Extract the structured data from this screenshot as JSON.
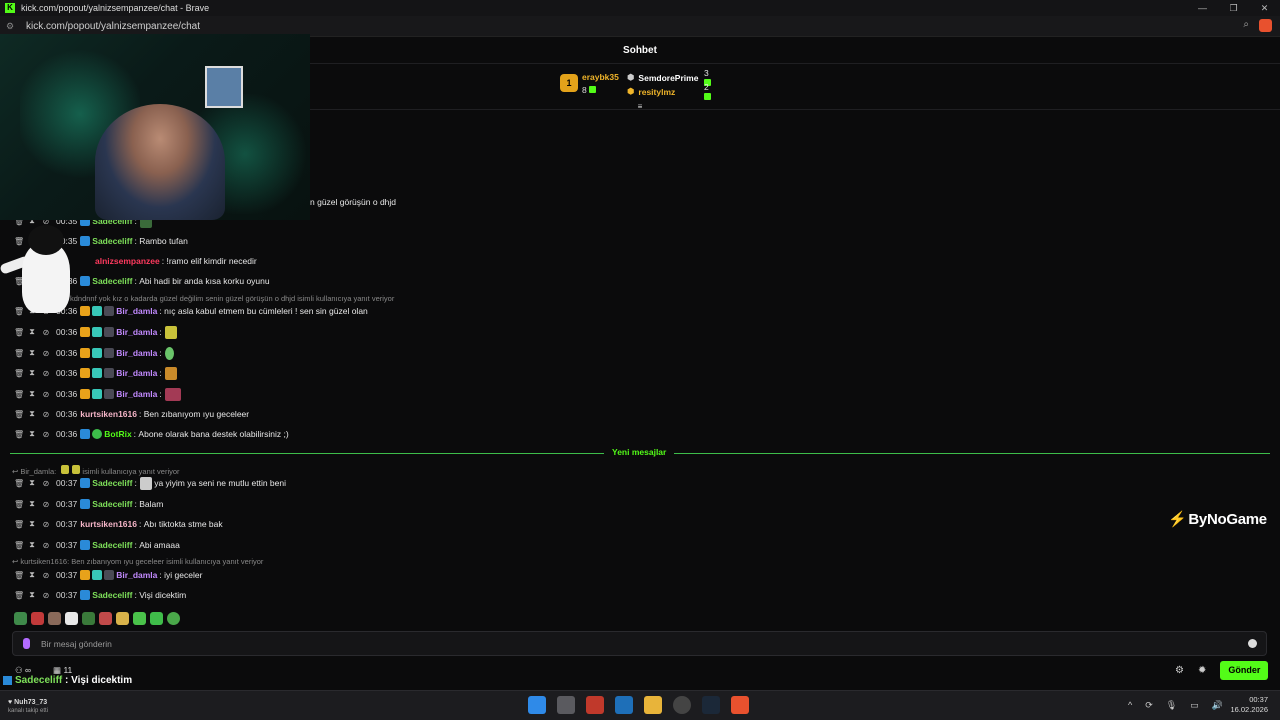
{
  "window": {
    "title": "kick.com/popout/yalnizsempanzee/chat - Brave",
    "controls": [
      "—",
      "❐",
      "✕"
    ]
  },
  "address_bar": {
    "url": "kick.com/popout/yalnizsempanzee/chat"
  },
  "chat_header": {
    "title": "Sohbet"
  },
  "leaderboard": {
    "rank": "1",
    "first": {
      "name": "eraybk35",
      "count": "8"
    },
    "others": [
      {
        "name": "SemdorePrime",
        "count": "3",
        "color": "#ffffff"
      },
      {
        "name": "resitylmz",
        "count": "2",
        "color": "#f0b52a"
      }
    ]
  },
  "partial_message": {
    "text": "n güzel görüşün o dhjd"
  },
  "messages_top": [
    {
      "time": "00:35",
      "user": "Sadeceliff",
      "sep": ":",
      "text": "",
      "cls": "un-green"
    },
    {
      "time": "00:35",
      "user": "Sadeceliff",
      "sep": ":",
      "text": "Rambo tufan",
      "cls": "un-green"
    },
    {
      "time": "",
      "user": "alnizsempanzee",
      "sep": ":",
      "text": "!ramo elif kimdir necedir",
      "cls": "un-red"
    },
    {
      "time": "00:36",
      "user": "Sadeceliff",
      "sep": ":",
      "text": "Abi hadi bir anda kısa korku oyunu",
      "cls": "un-green"
    }
  ],
  "reply_1": "kdndnnf yok kız o kadarda güzel değilim senin güzel görüşün o dhjd isimli kullanıcıya yanıt veriyor",
  "messages_mid": [
    {
      "time": "00:36",
      "user": "Bir_damla",
      "text": "nıç asla kabul etmem bu cümleleri ! sen sin güzel olan"
    },
    {
      "time": "00:36",
      "user": "Bir_damla",
      "text": ""
    },
    {
      "time": "00:36",
      "user": "Bir_damla",
      "text": ""
    },
    {
      "time": "00:36",
      "user": "Bir_damla",
      "text": ""
    },
    {
      "time": "00:36",
      "user": "Bir_damla",
      "text": ""
    }
  ],
  "msg_kurtsiken_1": {
    "time": "00:36",
    "user": "kurtsiken1616",
    "text": "Ben zıbanıyom ıyu geceleer"
  },
  "msg_botrix": {
    "time": "00:36",
    "user": "BotRix",
    "text": "Abone olarak bana destek olabilirsiniz ;)"
  },
  "new_messages_label": "Yeni mesajlar",
  "reply_2": {
    "user": "Bir_damla:",
    "text": "isimli kullanıcıya yanıt veriyor"
  },
  "messages_after": [
    {
      "time": "00:37",
      "user": "Sadeceliff",
      "text": "ya yiyim ya seni ne mutlu ettin beni"
    },
    {
      "time": "00:37",
      "user": "Sadeceliff",
      "text": "Balam"
    },
    {
      "time": "00:37",
      "user": "kurtsiken1616",
      "text": "Abı tiktokta stme bak"
    },
    {
      "time": "00:37",
      "user": "Sadeceliff",
      "text": "Abi amaaa"
    }
  ],
  "reply_3": "kurtsiken1616: Ben zıbanıyom ıyu geceleer isimli kullanıcıya yanıt veriyor",
  "msg_last_1": {
    "time": "00:37",
    "user": "Bir_damla",
    "text": "iyi geceler"
  },
  "msg_last_2": {
    "time": "00:37",
    "user": "Sadeceliff",
    "text": "Vişi dicektim"
  },
  "brand": "ByNoGame",
  "input": {
    "placeholder": "Bir mesaj gönderin"
  },
  "bottom_stats": {
    "users": "∞",
    "count": "11"
  },
  "send_label": "Gönder",
  "overlay": {
    "name": "Sadeceliff",
    "text": " : Vişi dicektim"
  },
  "taskbar": {
    "notify_name": "Nuh73_73",
    "notify_sub": "kanalı takip etti",
    "time": "00:37",
    "date": "16.02.2026"
  }
}
